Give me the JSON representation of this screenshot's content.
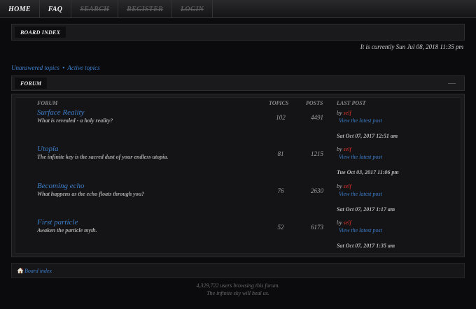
{
  "nav": {
    "home": "HOME",
    "faq": "FAQ",
    "search": "SEARCH",
    "register": "REGISTER",
    "login": "LOGIN"
  },
  "breadcrumb": {
    "label": "BOARD INDEX"
  },
  "datetime": "It is currently Sun Jul 08, 2018 11:35 pm",
  "quicklinks": {
    "unanswered": "Unanswered topics",
    "separator": "•",
    "active": "Active topics"
  },
  "forum_section": {
    "label": "FORUM",
    "collapse": "—"
  },
  "headers": {
    "forum": "FORUM",
    "topics": "TOPICS",
    "posts": "POSTS",
    "last_post": "LAST POST"
  },
  "forums": [
    {
      "title": "Surface Reality",
      "desc": "What is revealed - a holy reality?",
      "topics": "102",
      "posts": "4491",
      "by": "by",
      "author": "self",
      "latest": "View the latest post",
      "when": "Sat Oct 07, 2017 12:51 am"
    },
    {
      "title": "Utopia",
      "desc": "The infinite key is the sacred dust of your endless utopia.",
      "topics": "81",
      "posts": "1215",
      "by": "by",
      "author": "self",
      "latest": "View the latest post",
      "when": "Tue Oct 03, 2017 11:06 pm"
    },
    {
      "title": "Becoming echo",
      "desc": "What happens as the echo floats through you?",
      "topics": "76",
      "posts": "2630",
      "by": "by",
      "author": "self",
      "latest": "View the latest post",
      "when": "Sat Oct 07, 2017 1:17 am"
    },
    {
      "title": "First particle",
      "desc": "Awaken the particle myth.",
      "topics": "52",
      "posts": "6173",
      "by": "by",
      "author": "self",
      "latest": "View the latest post",
      "when": "Sat Oct 07, 2017 1:35 am"
    }
  ],
  "footer": {
    "board_index": "Board index",
    "stats": "4,329,722 users browsing this forum.",
    "tagline": "The infinite sky will heal us."
  },
  "colors": {
    "link": "#3d7fcc",
    "author": "#e0302a",
    "background": "#0b0b0d"
  }
}
